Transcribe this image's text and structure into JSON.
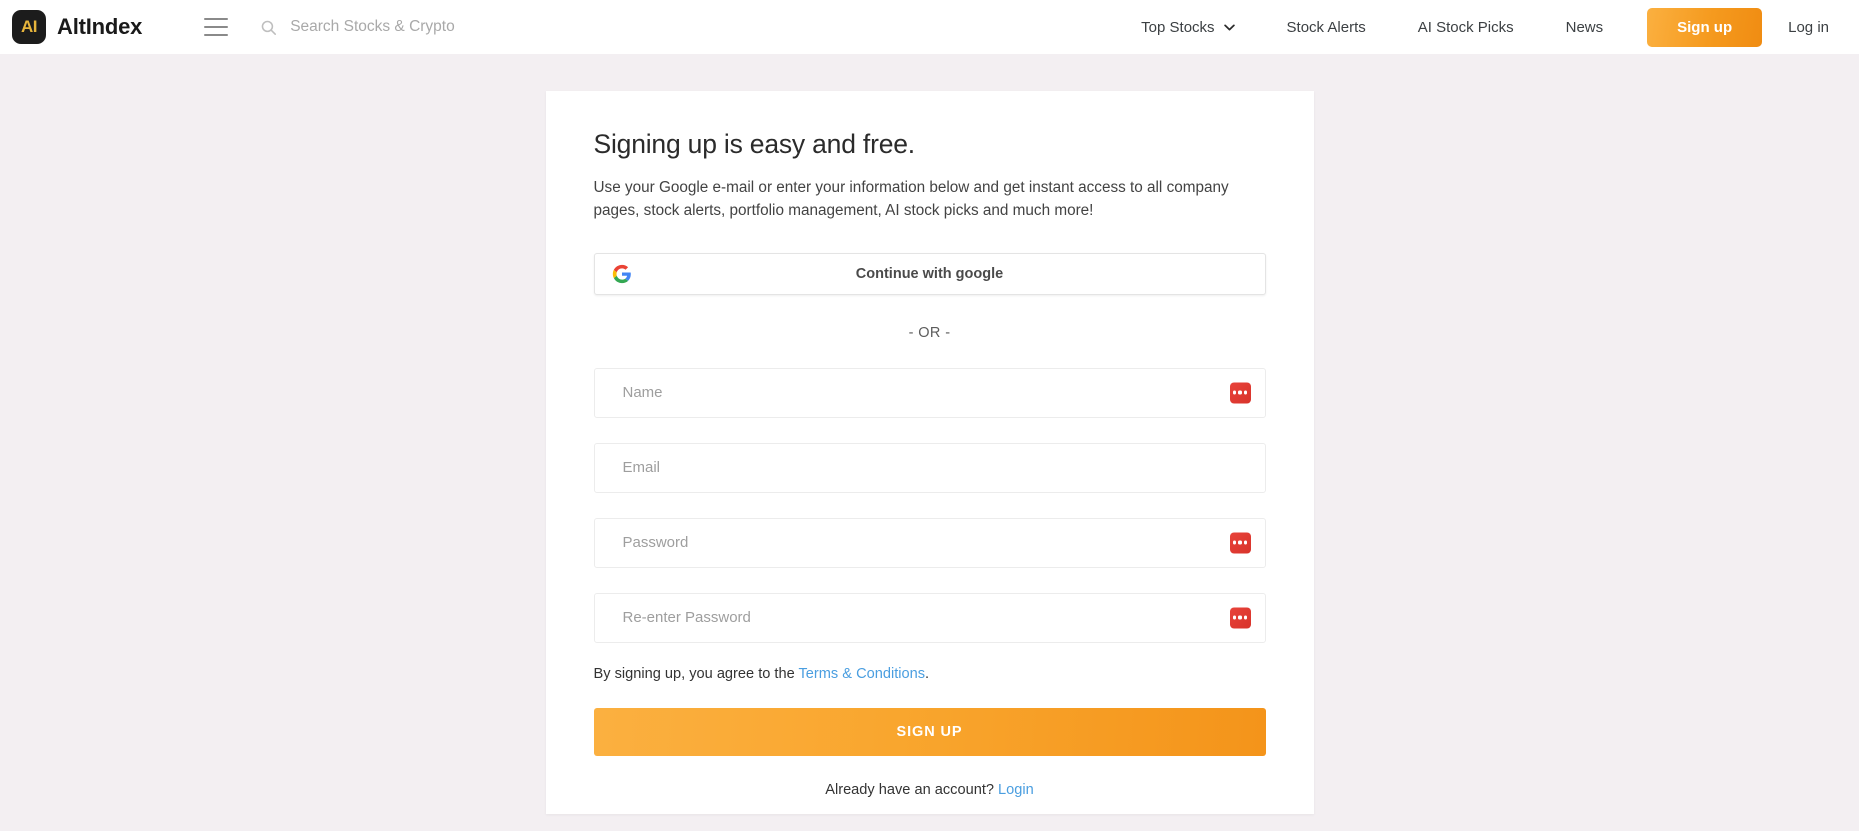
{
  "header": {
    "logo_text": "AI",
    "brand_name": "AltIndex",
    "menu_icon": "hamburger-menu-icon",
    "search": {
      "icon": "search-icon",
      "placeholder": "Search Stocks & Crypto",
      "value": ""
    },
    "nav_items": [
      {
        "label": "Top Stocks",
        "has_dropdown": true
      },
      {
        "label": "Stock Alerts",
        "has_dropdown": false
      },
      {
        "label": "AI Stock Picks",
        "has_dropdown": false
      },
      {
        "label": "News",
        "has_dropdown": false
      }
    ],
    "signup_button": "Sign up",
    "login_link": "Log in",
    "accent_color": "#f9a62e",
    "logo_accent_color": "#e7b53c"
  },
  "signup_card": {
    "title": "Signing up is easy and free.",
    "subtitle": "Use your Google e-mail or enter your information below and get instant access to all company pages, stock alerts, portfolio management, AI stock picks and much more!",
    "google_button": {
      "label": "Continue with google",
      "icon": "google-g-icon"
    },
    "divider_label": "- OR -",
    "fields": [
      {
        "name": "name",
        "placeholder": "Name",
        "value": "",
        "type": "text",
        "has_password_manager_icon": true
      },
      {
        "name": "email",
        "placeholder": "Email",
        "value": "",
        "type": "text",
        "has_password_manager_icon": false
      },
      {
        "name": "password",
        "placeholder": "Password",
        "value": "",
        "type": "password",
        "has_password_manager_icon": true
      },
      {
        "name": "confirm-password",
        "placeholder": "Re-enter Password",
        "value": "",
        "type": "password",
        "has_password_manager_icon": true
      }
    ],
    "terms": {
      "prefix": "By signing up, you agree to the ",
      "link": "Terms & Conditions",
      "suffix": "."
    },
    "submit_label": "SIGN UP",
    "footer": {
      "prefix": "Already have an account? ",
      "link": "Login"
    },
    "link_color": "#4a9ee0",
    "submit_color": "#f9a62e"
  },
  "page": {
    "background_color": "#f3eff2",
    "card_background_color": "#ffffff"
  }
}
